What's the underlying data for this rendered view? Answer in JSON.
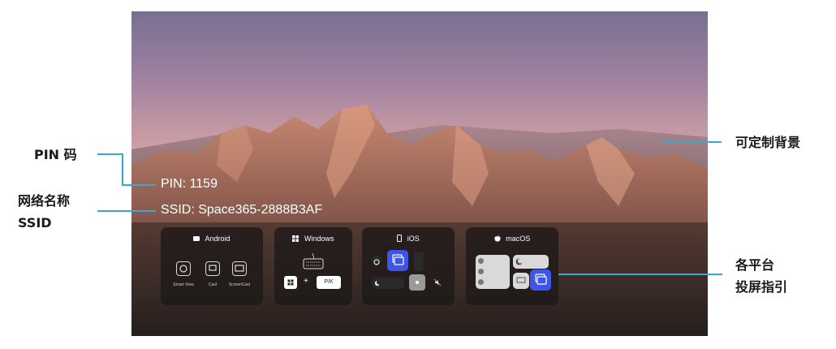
{
  "screen": {
    "pin_text": "PIN: 1159",
    "ssid_text": "SSID: Space365-2888B3AF"
  },
  "guides": [
    {
      "title": "Android",
      "icon": "android-icon",
      "items": [
        "Smart View",
        "Cast",
        "ScreenCast"
      ]
    },
    {
      "title": "Windows",
      "icon": "windows-icon",
      "keys": {
        "plus": "+",
        "combo": "P/K"
      }
    },
    {
      "title": "iOS",
      "icon": "phone-icon"
    },
    {
      "title": "macOS",
      "icon": "apple-icon"
    }
  ],
  "callouts": {
    "pin_label": "PIN 码",
    "ssid_label_line1": "网络名称",
    "ssid_label_line2": "SSID",
    "background_label": "可定制背景",
    "guide_label_line1": "各平台",
    "guide_label_line2": "投屏指引"
  },
  "colors": {
    "accent_line": "#3aa6d6",
    "mirror_button": "#3d55e8"
  }
}
